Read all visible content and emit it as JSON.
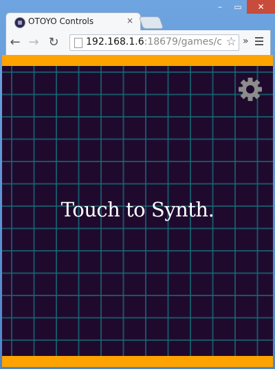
{
  "browser": {
    "tab_title": "OTOYO Controls",
    "tab_close": "×",
    "window_controls": {
      "minimize": "–",
      "maximize": "▭",
      "close": "✕"
    },
    "nav": {
      "back": "←",
      "forward": "→",
      "reload": "↻"
    },
    "url_host": "192.168.1.6",
    "url_rest": ":18679/games/c",
    "bookmark_star": "☆",
    "extensions": "»"
  },
  "page": {
    "prompt": "Touch to Synth.",
    "colors": {
      "accent": "#ffa300",
      "background": "#1f0a2e",
      "grid": "#146e78",
      "gear": "#8c8c8c"
    },
    "icons": {
      "settings": "gear-icon"
    }
  }
}
